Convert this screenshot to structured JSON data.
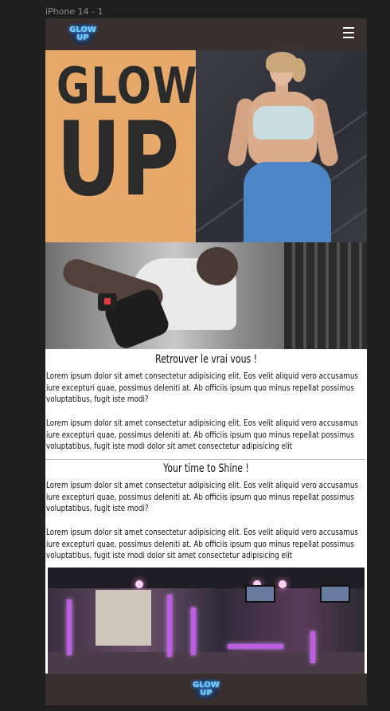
{
  "frame": {
    "label": "iPhone 14 - 1"
  },
  "header": {
    "logo": {
      "line1": "GLOW",
      "line2": "UP"
    },
    "menu_icon": "hamburger-icon"
  },
  "hero": {
    "title_line1": "GLOW",
    "title_line2": "UP"
  },
  "sections": [
    {
      "title": "Retrouver le vrai vous !",
      "paragraphs": [
        "Lorem ipsum dolor sit amet consectetur adipisicing elit. Eos velit aliquid vero accusamus iure excepturi quae, possimus deleniti at. Ab officiis ipsum quo minus repellat possimus voluptatibus, fugit iste modi?",
        "Lorem ipsum dolor sit amet consectetur adipisicing elit. Eos velit aliquid vero accusamus iure excepturi quae, possimus deleniti at. Ab officiis ipsum quo minus repellat possimus voluptatibus, fugit iste modi dolor sit amet consectetur adipisicing elit"
      ]
    },
    {
      "title": "Your time to Shine !",
      "paragraphs": [
        "Lorem ipsum dolor sit amet consectetur adipisicing elit. Eos velit aliquid vero accusamus iure excepturi quae, possimus deleniti at. Ab officiis ipsum quo minus repellat possimus voluptatibus, fugit iste modi?",
        "Lorem ipsum dolor sit amet consectetur adipisicing elit. Eos velit aliquid vero accusamus iure excepturi quae, possimus deleniti at. Ab officiis ipsum quo minus repellat possimus voluptatibus, fugit iste modi dolor sit amet consectetur adipisicing elit"
      ]
    }
  ],
  "footer": {
    "logo": {
      "line1": "GLOW",
      "line2": "UP"
    }
  },
  "colors": {
    "header_bg": "#3a2f2f",
    "hero_accent": "#e6a96a",
    "hero_text": "#2b2b2b",
    "logo_glow": "#7fd3ff",
    "canvas_bg": "#1e1e1e"
  }
}
